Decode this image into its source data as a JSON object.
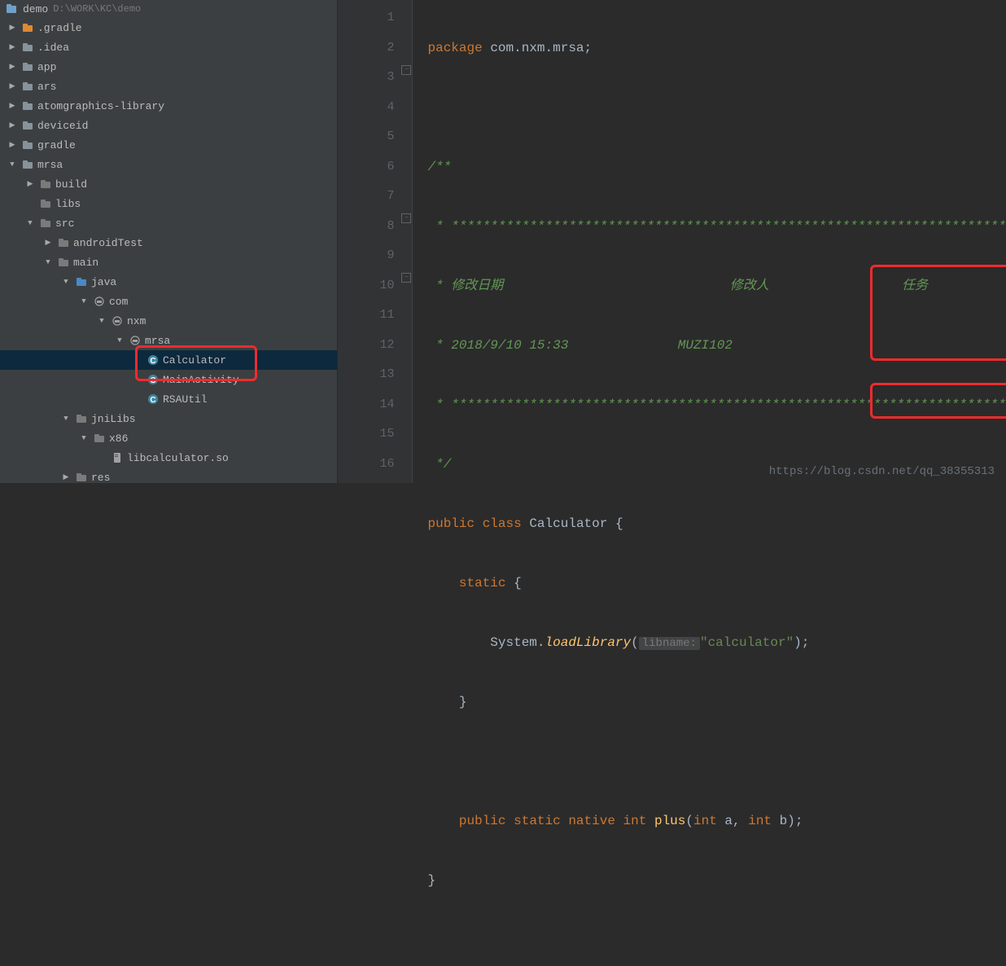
{
  "project": {
    "name": "demo",
    "path": "D:\\WORK\\KC\\demo"
  },
  "tree": [
    {
      "depth": 0,
      "arrow": "right",
      "icon": "folder-orange",
      "label": ".gradle"
    },
    {
      "depth": 0,
      "arrow": "right",
      "icon": "folder",
      "label": ".idea"
    },
    {
      "depth": 0,
      "arrow": "right",
      "icon": "folder",
      "label": "app"
    },
    {
      "depth": 0,
      "arrow": "right",
      "icon": "folder",
      "label": "ars"
    },
    {
      "depth": 0,
      "arrow": "right",
      "icon": "folder",
      "label": "atomgraphics-library"
    },
    {
      "depth": 0,
      "arrow": "right",
      "icon": "folder",
      "label": "deviceid"
    },
    {
      "depth": 0,
      "arrow": "right",
      "icon": "folder",
      "label": "gradle"
    },
    {
      "depth": 0,
      "arrow": "down",
      "icon": "folder",
      "label": "mrsa"
    },
    {
      "depth": 1,
      "arrow": "right",
      "icon": "folder-grey",
      "label": "build"
    },
    {
      "depth": 1,
      "arrow": "",
      "icon": "folder-grey",
      "label": "libs"
    },
    {
      "depth": 1,
      "arrow": "down",
      "icon": "folder-grey",
      "label": "src"
    },
    {
      "depth": 2,
      "arrow": "right",
      "icon": "folder-grey",
      "label": "androidTest"
    },
    {
      "depth": 2,
      "arrow": "down",
      "icon": "folder-grey",
      "label": "main"
    },
    {
      "depth": 3,
      "arrow": "down",
      "icon": "folder-blue",
      "label": "java"
    },
    {
      "depth": 4,
      "arrow": "down",
      "icon": "package",
      "label": "com"
    },
    {
      "depth": 5,
      "arrow": "down",
      "icon": "package",
      "label": "nxm"
    },
    {
      "depth": 6,
      "arrow": "down",
      "icon": "package",
      "label": "mrsa"
    },
    {
      "depth": 7,
      "arrow": "",
      "icon": "class",
      "label": "Calculator",
      "selected": true
    },
    {
      "depth": 7,
      "arrow": "",
      "icon": "class",
      "label": "MainActivity"
    },
    {
      "depth": 7,
      "arrow": "",
      "icon": "class",
      "label": "RSAUtil"
    },
    {
      "depth": 3,
      "arrow": "down",
      "icon": "folder-grey",
      "label": "jniLibs"
    },
    {
      "depth": 4,
      "arrow": "down",
      "icon": "folder-grey",
      "label": "x86"
    },
    {
      "depth": 5,
      "arrow": "",
      "icon": "file",
      "label": "libcalculator.so"
    },
    {
      "depth": 3,
      "arrow": "right",
      "icon": "folder-grey",
      "label": "res"
    }
  ],
  "code": {
    "package_kw": "package",
    "package_name": "com.nxm.mrsa",
    "comment_open": "/**",
    "comment_stars": " * ***********************************************************************",
    "comment_header_date": " * 修改日期",
    "comment_header_user": "修改人",
    "comment_header_task": "任务",
    "comment_date": " * 2018/9/10 15:33",
    "comment_user": "MUZI102",
    "comment_close": " */",
    "public_kw": "public",
    "class_kw": "class",
    "class_name": "Calculator",
    "static_kw": "static",
    "system": "System.",
    "loadlib": "loadLibrary",
    "hint": "libname:",
    "lib_str": "\"calculator\"",
    "native_kw": "native",
    "int_kw": "int",
    "method_name": "plus",
    "arg_a": "a",
    "arg_b": "b"
  },
  "line_numbers": [
    "1",
    "2",
    "3",
    "4",
    "5",
    "6",
    "7",
    "8",
    "9",
    "10",
    "11",
    "12",
    "13",
    "14",
    "15",
    "16"
  ],
  "watermark": "https://blog.csdn.net/qq_38355313"
}
